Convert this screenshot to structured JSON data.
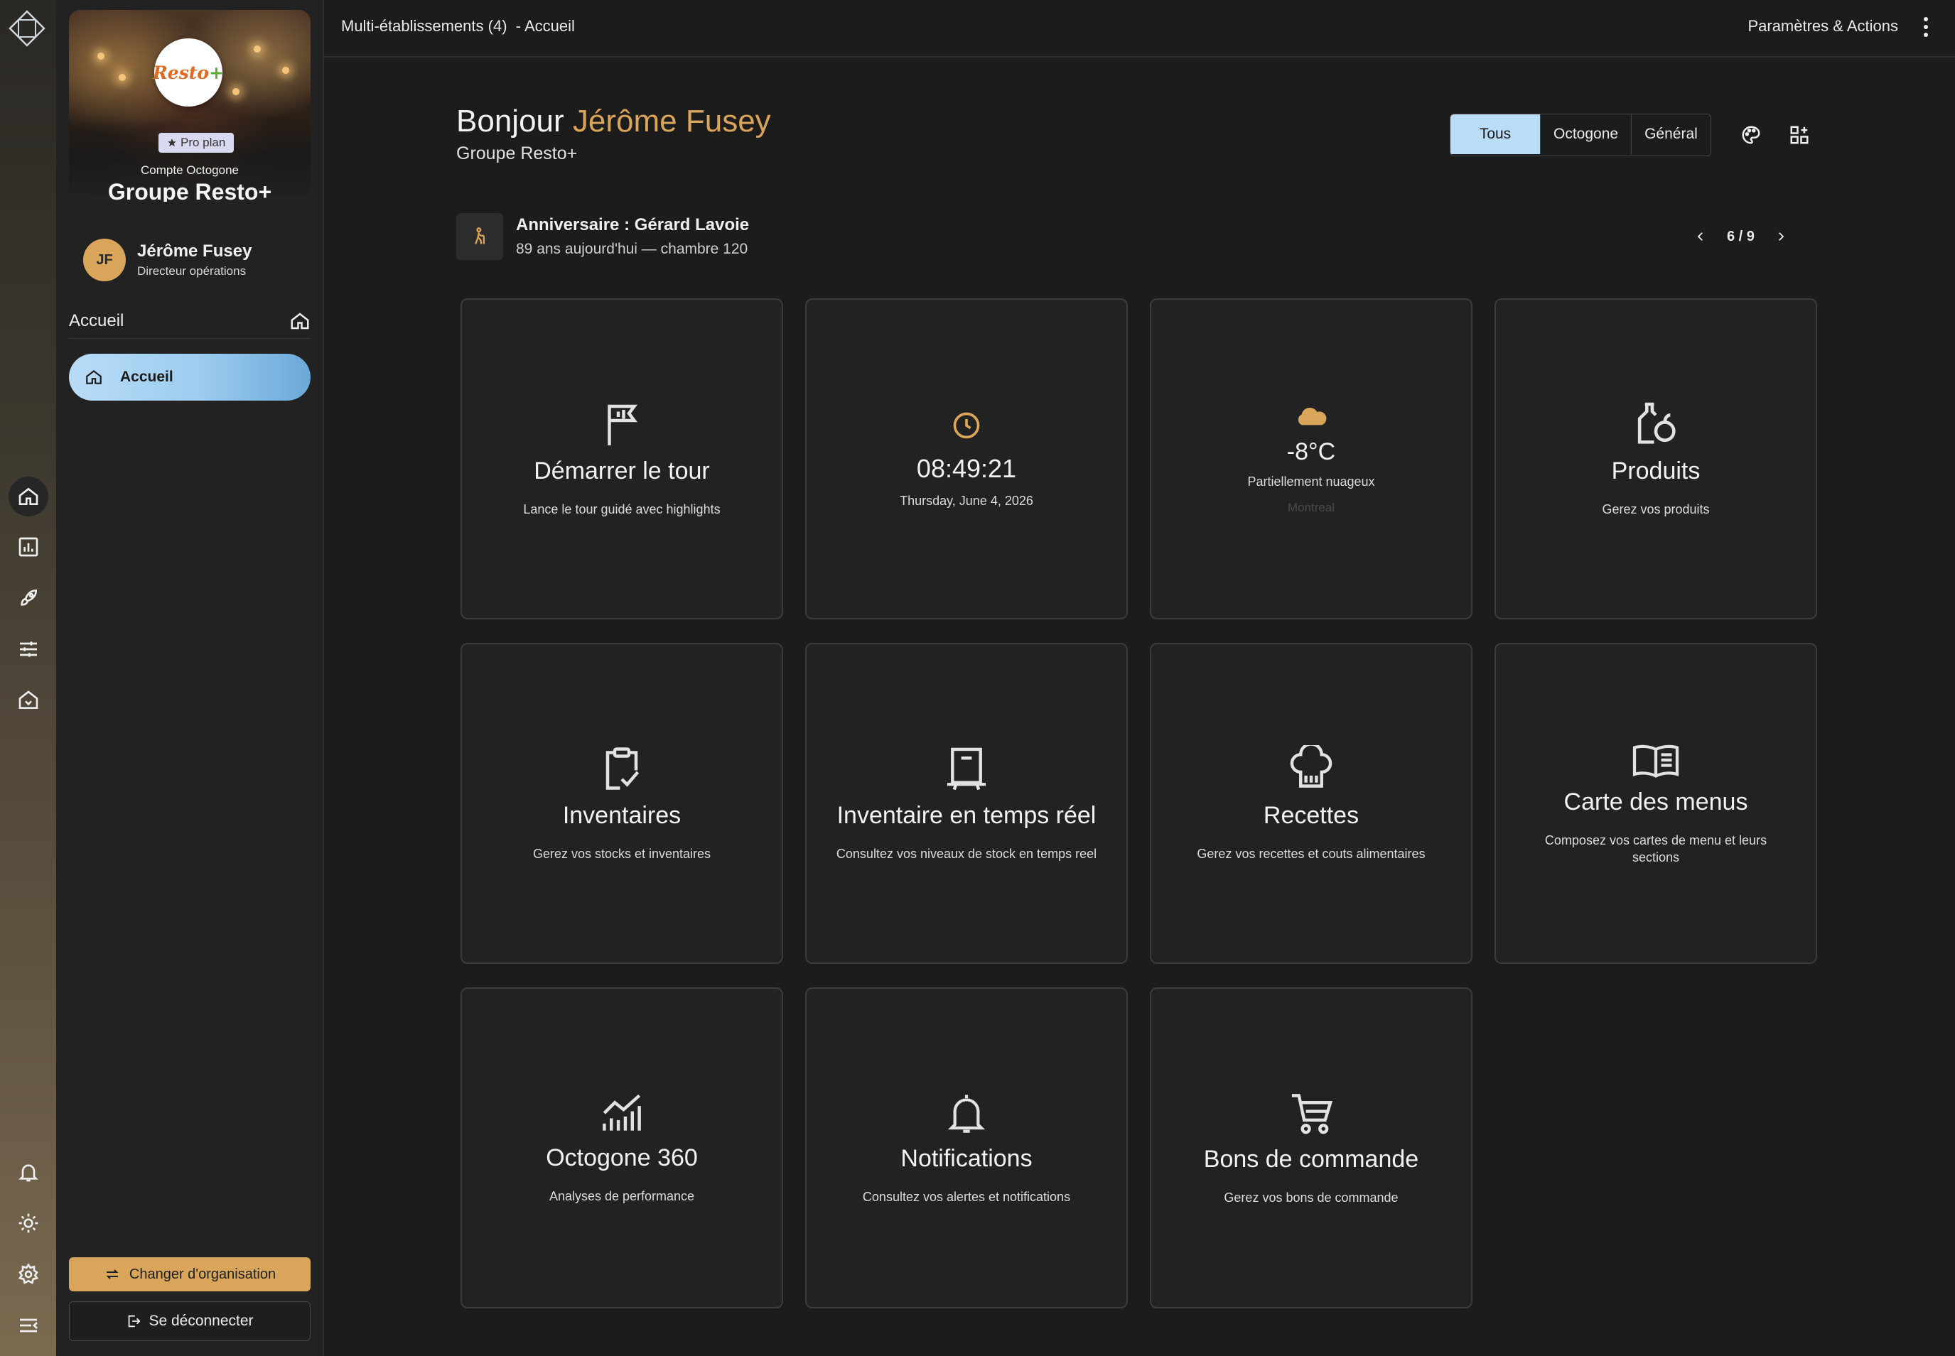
{
  "topbar": {
    "breadcrumb": "Multi-établissements (4)  - Accueil",
    "actions_label": "Paramètres & Actions"
  },
  "sidebar": {
    "account_label": "Compte Octogone",
    "account_name": "Groupe Resto+",
    "plan_badge": "Pro plan",
    "logo_text": "Resto",
    "logo_plus": "+",
    "user": {
      "initials": "JF",
      "name": "Jérôme Fusey",
      "role": "Directeur opérations"
    },
    "section_title": "Accueil",
    "nav_active_label": "Accueil",
    "change_org_label": "Changer d'organisation",
    "logout_label": "Se déconnecter"
  },
  "rail": {
    "icons": [
      "app-logo-icon",
      "home-icon",
      "reports-icon",
      "rocket-icon",
      "sliders-icon",
      "establishment-icon",
      "bell-icon",
      "sun-icon",
      "settings-icon",
      "collapse-menu-icon"
    ]
  },
  "main": {
    "greeting_prefix": "Bonjour",
    "greeting_name": "Jérôme Fusey",
    "org_name": "Groupe Resto+",
    "filters": [
      "Tous",
      "Octogone",
      "Général"
    ],
    "active_filter": "Tous",
    "announcement": {
      "title": "Anniversaire : Gérard Lavoie",
      "subtitle": "89 ans aujourd'hui — chambre 120",
      "pager": "6 / 9"
    },
    "cards": {
      "tour": {
        "title": "Démarrer le tour",
        "desc": "Lance le tour guidé avec highlights"
      },
      "clock": {
        "time": "08:49:21",
        "date": "Thursday, June 4, 2026"
      },
      "weather": {
        "temp": "-8°C",
        "condition": "Partiellement nuageux",
        "city": "Montreal"
      },
      "produits": {
        "title": "Produits",
        "desc": "Gerez vos produits"
      },
      "inventaires": {
        "title": "Inventaires",
        "desc": "Gerez vos stocks et inventaires"
      },
      "inventaire_rt": {
        "title": "Inventaire en temps réel",
        "desc": "Consultez vos niveaux de stock en temps reel"
      },
      "recettes": {
        "title": "Recettes",
        "desc": "Gerez vos recettes et couts alimentaires"
      },
      "carte_menus": {
        "title": "Carte des menus",
        "desc": "Composez vos cartes de menu et leurs sections"
      },
      "octogone360": {
        "title": "Octogone 360",
        "desc": "Analyses de performance"
      },
      "notifications": {
        "title": "Notifications",
        "desc": "Consultez vos alertes et notifications"
      },
      "bons_commande": {
        "title": "Bons de commande",
        "desc": "Gerez vos bons de commande"
      }
    }
  },
  "colors": {
    "accent_gold": "#d9a55a",
    "accent_blue": "#b9dcf7",
    "background": "#1c1c1c",
    "card": "#222222"
  }
}
